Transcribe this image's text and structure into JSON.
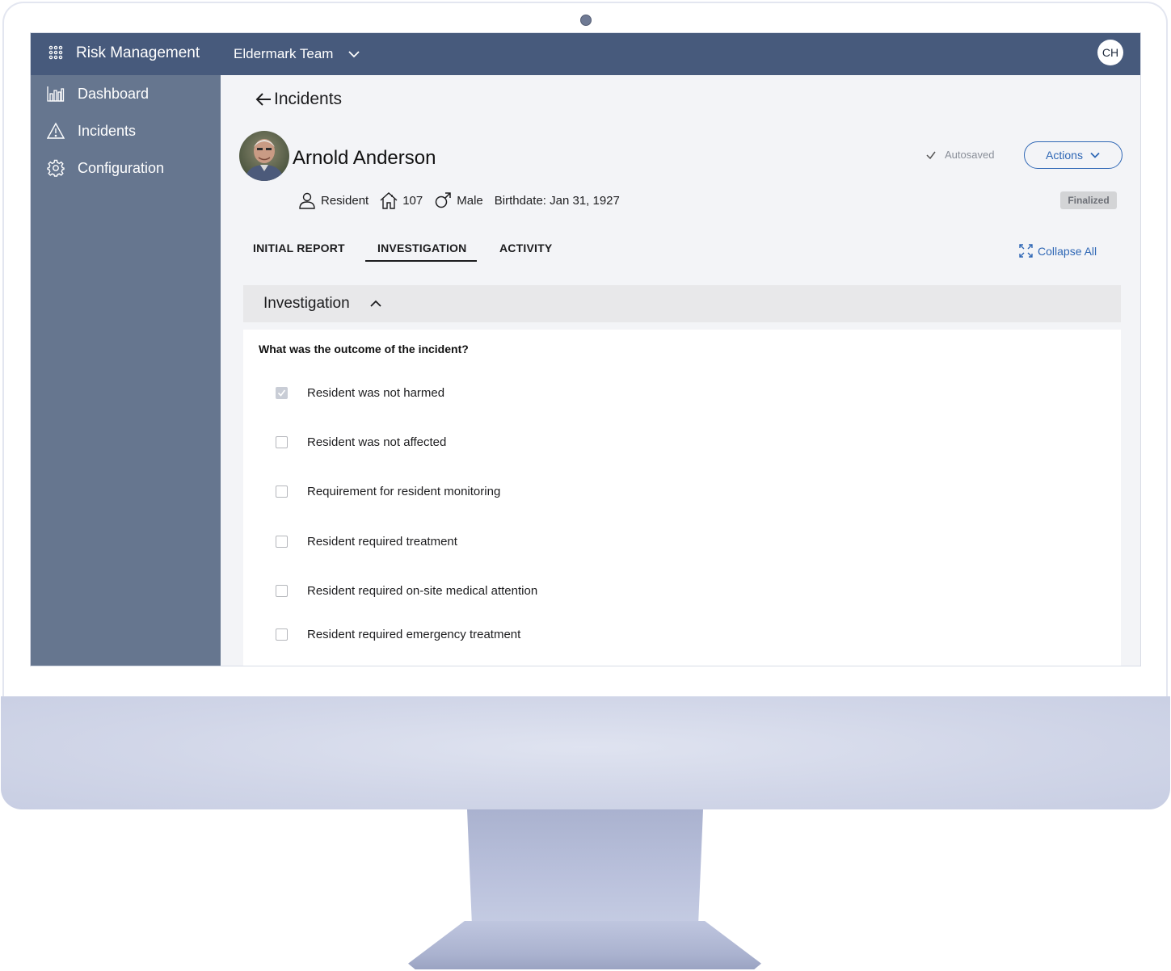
{
  "header": {
    "app_title": "Risk Management",
    "team_name": "Eldermark Team",
    "user_initials": "CH"
  },
  "sidebar": {
    "items": [
      {
        "label": "Dashboard",
        "icon": "bar-chart-icon"
      },
      {
        "label": "Incidents",
        "icon": "warning-icon"
      },
      {
        "label": "Configuration",
        "icon": "gear-icon"
      }
    ]
  },
  "page": {
    "back_label": "Incidents",
    "resident": {
      "name": "Arnold Anderson",
      "role": "Resident",
      "room": "107",
      "gender": "Male",
      "birthdate": "Birthdate: Jan 31, 1927"
    },
    "autosaved": "Autosaved",
    "actions_label": "Actions",
    "status_badge": "Finalized",
    "tabs": [
      {
        "label": "INITIAL REPORT",
        "active": false
      },
      {
        "label": "INVESTIGATION",
        "active": true
      },
      {
        "label": "ACTIVITY",
        "active": false
      }
    ],
    "collapse_all": "Collapse All",
    "section": {
      "title": "Investigation",
      "question": "What was the outcome of the incident?",
      "options": [
        {
          "label": "Resident was not harmed",
          "checked": true
        },
        {
          "label": "Resident was not affected",
          "checked": false
        },
        {
          "label": "Requirement for resident monitoring",
          "checked": false
        },
        {
          "label": "Resident required treatment",
          "checked": false
        },
        {
          "label": "Resident required on-site medical attention",
          "checked": false
        },
        {
          "label": "Resident required emergency treatment",
          "checked": false
        }
      ]
    }
  },
  "colors": {
    "topbar": "#475a7c",
    "sidebar": "#66768f",
    "accent": "#2f67b5"
  }
}
